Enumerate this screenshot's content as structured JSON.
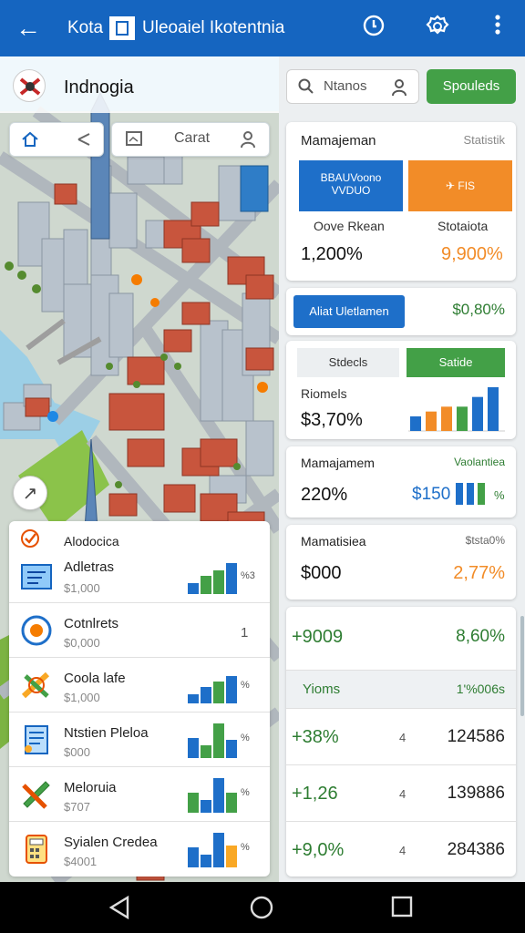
{
  "appbar": {
    "title_a": "Kota",
    "title_b": "Uleoaiel Ikotentnia",
    "icons": [
      "back-arrow-icon",
      "clock-icon",
      "settings-gear-icon",
      "overflow-menu-icon"
    ]
  },
  "location": {
    "name": "Indnogia"
  },
  "map_controls": {
    "field_label": "Carat"
  },
  "search": {
    "placeholder": "Ntanos",
    "button_label": "Spouleds"
  },
  "stats_card": {
    "heading": "Mamajeman",
    "subheading": "Statistik",
    "tile_left_text": "BBAUVoono\nVVDUO",
    "tile_right_text": "FIS",
    "label_left": "Oove Rkean",
    "label_right": "Stotaiota",
    "value_left": "1,200%",
    "value_right": "9,900%"
  },
  "action_card": {
    "button_label": "Aliat Uletlamen",
    "value": "$0,80%"
  },
  "tabs_card": {
    "tab_inactive": "Stdecls",
    "tab_active": "Satide",
    "label": "Riomels",
    "value": "$3,70%",
    "chart_values": [
      3,
      4,
      5,
      5,
      7,
      9
    ]
  },
  "mgmt_card": {
    "heading": "Mamajamem",
    "subheading": "Vaolantiea",
    "value": "220%",
    "side_value": "$150",
    "side_pct": "%"
  },
  "mat_card": {
    "heading": "Mamatisiea",
    "subheading": "$tsta0%",
    "value": "$000",
    "side_value": "2,77%"
  },
  "table": {
    "top_row": {
      "a": "+9009",
      "b": "8,60%"
    },
    "header": {
      "a": "Yioms",
      "b": "1'%006s"
    },
    "rows": [
      {
        "a": "+38%",
        "m": "4",
        "b": "124586"
      },
      {
        "a": "+1,26",
        "m": "4",
        "b": "139886"
      },
      {
        "a": "+9,0%",
        "m": "4",
        "b": "284386"
      }
    ]
  },
  "left_list": [
    {
      "title": "Alodocica",
      "icon": "checkbox-icon"
    },
    {
      "title": "Adletras",
      "sub": "$1,000",
      "pct": "%3",
      "icon": "blueprint-icon",
      "bars": [
        1,
        2,
        3,
        4
      ]
    },
    {
      "title": "Cotnlrets",
      "sub": "$0,000",
      "side": "1",
      "icon": "circle-target-icon"
    },
    {
      "title": "Coola lafe",
      "sub": "$1,000",
      "pct": "%",
      "icon": "pencil-cross-icon",
      "bars": [
        1,
        2,
        3,
        4
      ]
    },
    {
      "title": "Ntstien Pleloa",
      "sub": "$000",
      "pct": "%",
      "icon": "document-icon",
      "bars": [
        2,
        1,
        4,
        2
      ]
    },
    {
      "title": "Meloruia",
      "sub": "$707",
      "pct": "%",
      "icon": "ruler-pencil-icon",
      "bars": [
        2,
        1,
        4,
        2
      ]
    },
    {
      "title": "Syialen Credea",
      "sub": "$4001",
      "pct": "%",
      "icon": "calculator-icon",
      "bars": [
        2,
        1,
        4,
        2
      ]
    }
  ],
  "navbar": {
    "icons": [
      "nav-back-icon",
      "nav-home-icon",
      "nav-recents-icon"
    ]
  }
}
